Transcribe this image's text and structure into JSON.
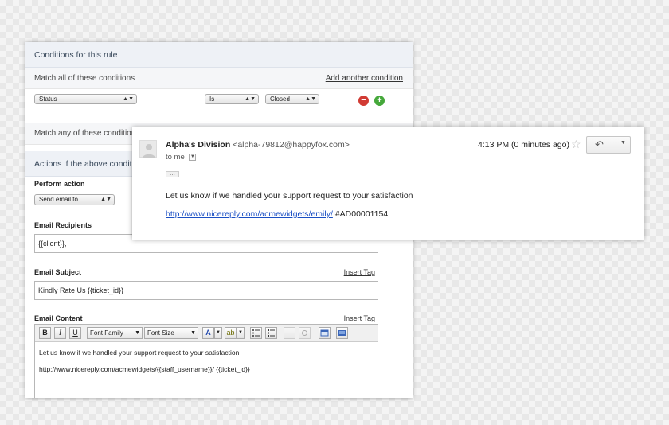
{
  "rule_panel": {
    "conditions_header": "Conditions for this rule",
    "match_all_label": "Match all of these conditions",
    "add_condition_link": "Add another condition",
    "condition": {
      "field": "Status",
      "operator": "Is",
      "value": "Closed"
    },
    "match_any_label": "Match any of these conditions",
    "actions_header": "Actions if the above conditions",
    "perform_action_label": "Perform action",
    "perform_action_value": "Send email to",
    "recipients_label": "Email Recipients",
    "recipients_value": "{{client}},",
    "subject_label": "Email Subject",
    "subject_value": "Kindly Rate Us  {{ticket_id}}",
    "insert_tag_label": "Insert Tag",
    "content_label": "Email Content",
    "toolbar": {
      "bold": "B",
      "italic": "I",
      "underline": "U",
      "font_family": "Font Family",
      "font_size": "Font Size"
    },
    "content_line1": "Let us know if we handled your support request to your satisfaction",
    "content_line2": "http://www.nicereply.com/acmewidgets/{{staff_username}}/ {{ticket_id}}"
  },
  "email": {
    "sender_name": "Alpha's Division",
    "sender_address": "<alpha-79812@happyfox.com>",
    "to_label": "to me",
    "time": "4:13 PM (0 minutes ago)",
    "ellipsis": "...",
    "body": "Let us know if we handled your support request to your satisfaction",
    "link": "http://www.nicereply.com/acmewidgets/emily/",
    "ticket_ref": "#AD00001154"
  },
  "icons": {
    "star": "star-icon",
    "reply": "reply-icon",
    "more": "chevron-down-icon",
    "remove_condition": "minus-circle-icon",
    "add_condition": "plus-circle-icon"
  },
  "colors": {
    "link_blue": "#1a4fc4",
    "remove_red": "#d13b34",
    "add_green": "#45a83a",
    "header_bg": "#eef1f6"
  }
}
